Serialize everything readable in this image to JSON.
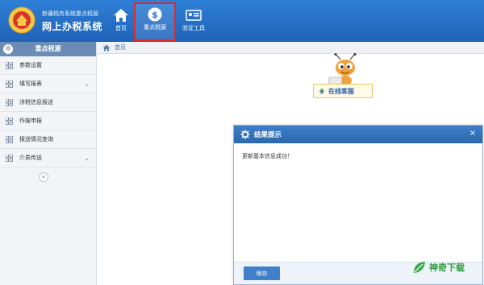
{
  "header": {
    "brand_subtitle": "新疆税务系统重点税源",
    "brand_title": "网上办税系统",
    "nav": [
      {
        "label": "首页",
        "icon": "home-icon"
      },
      {
        "label": "重点税源",
        "icon": "dollar-circle-icon",
        "active": true
      },
      {
        "label": "验证工具",
        "icon": "id-card-icon"
      }
    ]
  },
  "sidebar": {
    "title": "重点税源",
    "items": [
      {
        "label": "参数设置",
        "has_submenu": false
      },
      {
        "label": "填写报表",
        "has_submenu": true
      },
      {
        "label": "涉税信息报送",
        "has_submenu": false
      },
      {
        "label": "作废申报",
        "has_submenu": false
      },
      {
        "label": "报送情况查询",
        "has_submenu": false
      },
      {
        "label": "介质传送",
        "has_submenu": true
      }
    ],
    "collapse_glyph": "«"
  },
  "breadcrumb": {
    "label": "首页"
  },
  "service": {
    "label": "在线客服"
  },
  "dialog": {
    "title": "结果提示",
    "message": "更新基本信息成功！",
    "close_glyph": "×",
    "save_label": "保存"
  },
  "watermark": {
    "text": "神奇下载"
  },
  "colors": {
    "header_blue": "#2a72c9",
    "sidebar_head": "#6a8cb5",
    "highlight_red": "#e02a2a",
    "dialog_blue": "#3475bd",
    "watermark_green": "#2e9b3e"
  }
}
